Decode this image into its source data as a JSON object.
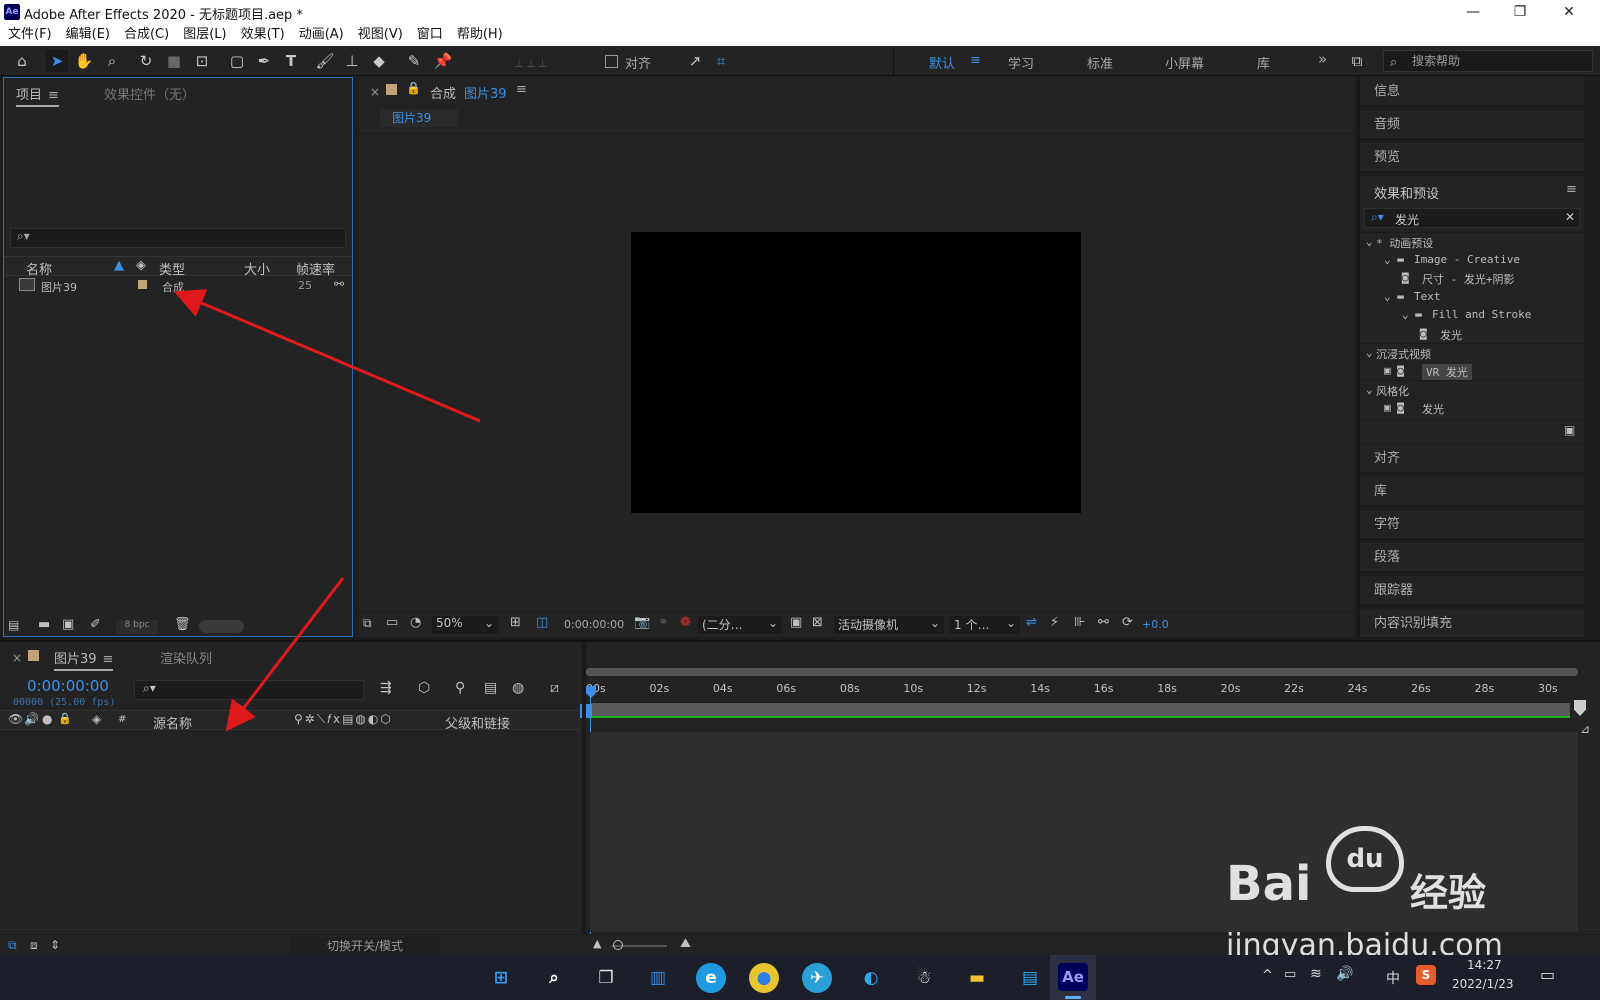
{
  "window": {
    "title": "Adobe After Effects 2020 - 无标题项目.aep *",
    "logo": "Ae",
    "minimize": "—",
    "maximize": "❐",
    "close": "✕"
  },
  "menu": [
    "文件(F)",
    "编辑(E)",
    "合成(C)",
    "图层(L)",
    "效果(T)",
    "动画(A)",
    "视图(V)",
    "窗口",
    "帮助(H)"
  ],
  "toolbar": {
    "align_label": "对齐",
    "workspaces": [
      "默认",
      "学习",
      "标准",
      "小屏幕",
      "库"
    ],
    "more": "»",
    "search_placeholder": "搜索帮助"
  },
  "project": {
    "tab_project": "项目",
    "tab_effects": "效果控件（无）",
    "columns": {
      "name": "名称",
      "type": "类型",
      "size": "大小",
      "fps": "帧速率"
    },
    "items": [
      {
        "name": "图片39",
        "type": "合成",
        "fps": "25"
      }
    ],
    "bpc": "8 bpc"
  },
  "composition": {
    "tab_prefix": "合成",
    "tab_name": "图片39",
    "subtab": "图片39",
    "zoom": "50%",
    "timecode": "0:00:00:00",
    "resolution": "(二分…",
    "camera": "活动摄像机",
    "views": "1 个…",
    "exposure": "+0.0"
  },
  "right_panels": {
    "top": [
      "信息",
      "音频",
      "预览"
    ],
    "effects_title": "效果和预设",
    "effects_search": "发光",
    "tree": [
      {
        "label": "* 动画预设",
        "indent": 0,
        "type": "folder-open"
      },
      {
        "label": "Image - Creative",
        "indent": 1,
        "type": "folder"
      },
      {
        "label": "尺寸 - 发光+阴影",
        "indent": 2,
        "type": "preset"
      },
      {
        "label": "Text",
        "indent": 1,
        "type": "folder"
      },
      {
        "label": "Fill and Stroke",
        "indent": 2,
        "type": "folder"
      },
      {
        "label": "发光",
        "indent": 3,
        "type": "preset"
      },
      {
        "label": "沉浸式视频",
        "indent": 0,
        "type": "folder-open"
      },
      {
        "label": "VR 发光",
        "indent": 1,
        "type": "effect",
        "selected": true
      },
      {
        "label": "风格化",
        "indent": 0,
        "type": "folder-open"
      },
      {
        "label": "发光",
        "indent": 1,
        "type": "effect"
      }
    ],
    "bottom": [
      "对齐",
      "库",
      "字符",
      "段落",
      "跟踪器",
      "内容识别填充"
    ]
  },
  "timeline": {
    "tab_name": "图片39",
    "tab_render": "渲染队列",
    "timecode": "0:00:00:00",
    "frame_info": "00000 (25.00 fps)",
    "col_source": "源名称",
    "col_parent": "父级和链接",
    "col_hash": "#",
    "ruler": [
      "00s",
      "02s",
      "04s",
      "06s",
      "08s",
      "10s",
      "12s",
      "14s",
      "16s",
      "18s",
      "20s",
      "22s",
      "24s",
      "26s",
      "28s",
      "30s"
    ],
    "toggle_label": "切换开关/模式"
  },
  "watermark": {
    "brand": "Bai",
    "du": "du",
    "site_cn": "经验",
    "url": "jingyan.baidu.com"
  },
  "taskbar": {
    "time": "14:27",
    "date": "2022/1/23",
    "ime": "中"
  },
  "colors": {
    "accent": "#2d8ceb",
    "arrow": "#e0191b",
    "bg": "#1d1d1d",
    "panel": "#232323"
  }
}
